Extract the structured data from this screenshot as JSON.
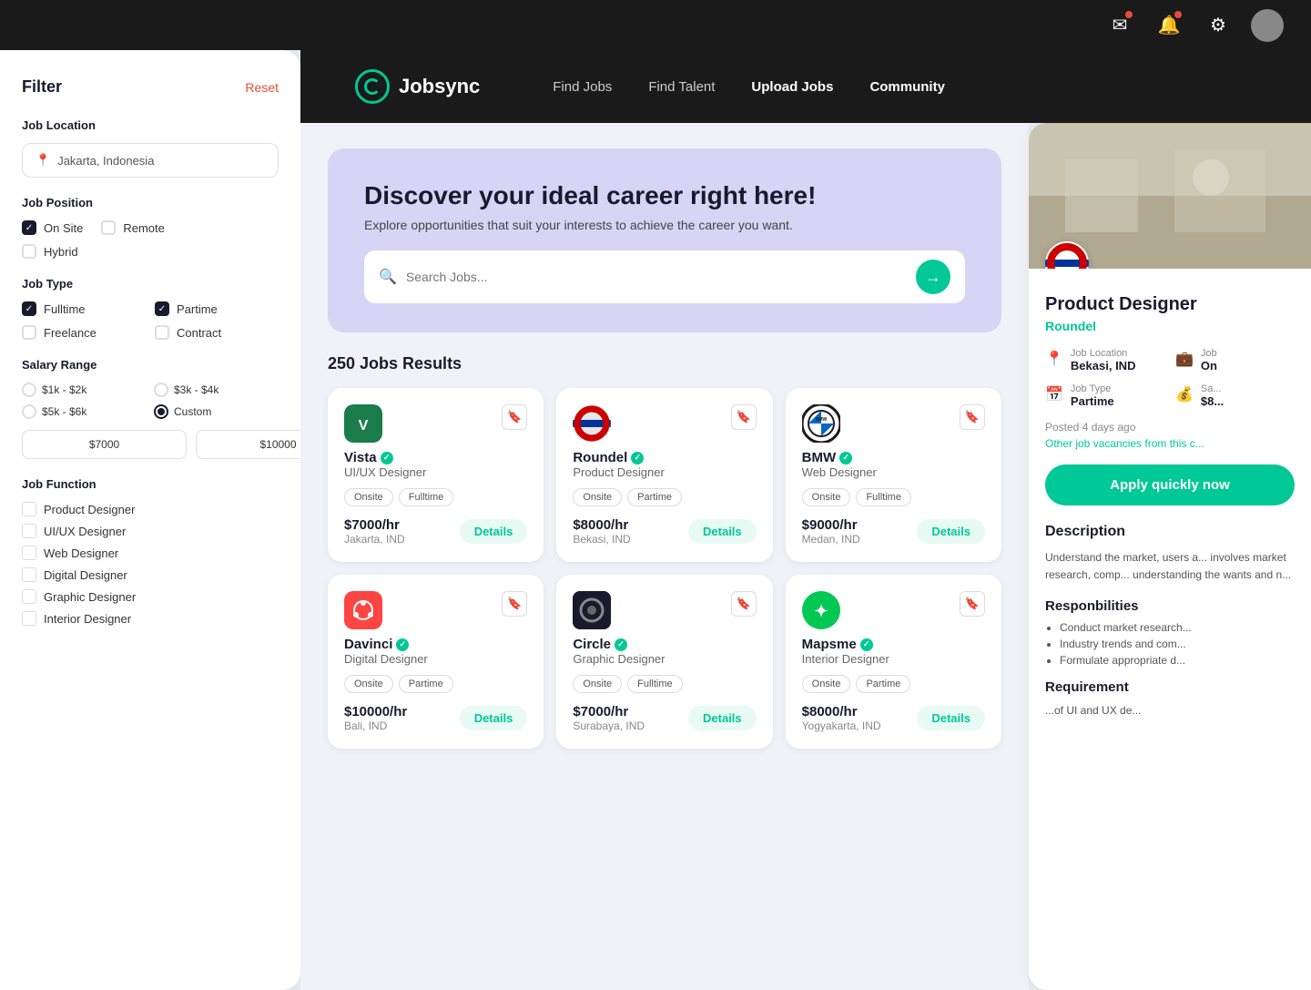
{
  "topbar": {
    "icons": [
      "message-icon",
      "notification-icon",
      "settings-icon",
      "avatar-icon"
    ]
  },
  "header": {
    "logo_text": "Jobsync",
    "nav": [
      {
        "label": "Find Jobs",
        "key": "find-jobs"
      },
      {
        "label": "Find Talent",
        "key": "find-talent"
      },
      {
        "label": "Upload Jobs",
        "key": "upload-jobs"
      },
      {
        "label": "Community",
        "key": "community"
      }
    ]
  },
  "sidebar": {
    "title": "Filter",
    "reset_label": "Reset",
    "job_location": {
      "label": "Job Location",
      "value": "Jakarta, Indonesia"
    },
    "job_position": {
      "label": "Job Position",
      "options": [
        {
          "label": "On Site",
          "checked": true
        },
        {
          "label": "Remote",
          "checked": false
        },
        {
          "label": "Hybrid",
          "checked": false
        }
      ]
    },
    "job_type": {
      "label": "Job Type",
      "options": [
        {
          "label": "Fulltime",
          "checked": true
        },
        {
          "label": "Partime",
          "checked": true
        },
        {
          "label": "Freelance",
          "checked": false
        },
        {
          "label": "Contract",
          "checked": false
        }
      ]
    },
    "salary_range": {
      "label": "Salary Range",
      "options": [
        {
          "label": "$1k - $2k",
          "checked": false
        },
        {
          "label": "$3k - $4k",
          "checked": false
        },
        {
          "label": "$5k - $6k",
          "checked": false
        },
        {
          "label": "Custom",
          "checked": true
        }
      ],
      "min": "$7000",
      "max": "$10000"
    },
    "job_function": {
      "label": "Job Function",
      "options": [
        {
          "label": "Product Designer",
          "checked": false
        },
        {
          "label": "UI/UX Designer",
          "checked": false
        },
        {
          "label": "Web Designer",
          "checked": false
        },
        {
          "label": "Digital Designer",
          "checked": false
        },
        {
          "label": "Graphic Designer",
          "checked": false
        },
        {
          "label": "Interior Designer",
          "checked": false
        }
      ]
    }
  },
  "hero": {
    "title": "Discover your ideal career right here!",
    "subtitle": "Explore opportunities that suit your interests to achieve the career you want.",
    "search_placeholder": "Search Jobs..."
  },
  "results": {
    "count": "250 Jobs Results"
  },
  "jobs": [
    {
      "id": "vista",
      "company": "Vista",
      "verified": true,
      "role": "UI/UX Designer",
      "tags": [
        "Onsite",
        "Fulltime"
      ],
      "salary": "$7000/hr",
      "location": "Jakarta, IND",
      "logo_type": "vista"
    },
    {
      "id": "roundel",
      "company": "Roundel",
      "verified": true,
      "role": "Product Designer",
      "tags": [
        "Onsite",
        "Partime"
      ],
      "salary": "$8000/hr",
      "location": "Bekasi, IND",
      "logo_type": "roundel"
    },
    {
      "id": "bmw",
      "company": "BMW",
      "verified": true,
      "role": "Web Designer",
      "tags": [
        "Onsite",
        "Fulltime"
      ],
      "salary": "$9000/hr",
      "location": "Medan, IND",
      "logo_type": "bmw"
    },
    {
      "id": "davinci",
      "company": "Davinci",
      "verified": true,
      "role": "Digital Designer",
      "tags": [
        "Onsite",
        "Partime"
      ],
      "salary": "$10000/hr",
      "location": "Bali, IND",
      "logo_type": "davinci"
    },
    {
      "id": "circle",
      "company": "Circle",
      "verified": true,
      "role": "Graphic Designer",
      "tags": [
        "Onsite",
        "Fulltime"
      ],
      "salary": "$7000/hr",
      "location": "Surabaya, IND",
      "logo_type": "circle"
    },
    {
      "id": "mapsme",
      "company": "Mapsme",
      "verified": true,
      "role": "Interior Designer",
      "tags": [
        "Onsite",
        "Partime"
      ],
      "salary": "$8000/hr",
      "location": "Yogyakarta, IND",
      "logo_type": "mapsme"
    }
  ],
  "right_panel": {
    "job_title": "Product Designer",
    "company_name": "Roundel",
    "job_location_label": "Job Location",
    "job_location_value": "Bekasi, IND",
    "job_type_label": "Job Type",
    "job_type_value": "Partime",
    "salary_label": "Sa...",
    "salary_value": "$8...",
    "job_label2": "Job",
    "job_value2": "On",
    "posted": "Posted 4 days ago",
    "other_jobs": "Other job vacancies from this c...",
    "apply_label": "Apply quickly now",
    "description_title": "Description",
    "description_text": "Understand the market, users a... involves market research, comp... understanding the wants and n...",
    "responsibilities_title": "Responbilities",
    "responsibilities": [
      "Conduct market research...",
      "Industry trends and com...",
      "Formulate appropriate d..."
    ],
    "requirement_title": "Requirement",
    "requirement_text": "...of UI and UX de..."
  }
}
